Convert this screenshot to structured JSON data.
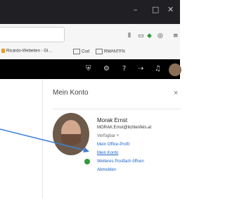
{
  "window": {
    "min_icon": "minimize-icon",
    "max_icon": "maximize-icon",
    "close_icon": "close-icon",
    "min_glyph": "–",
    "max_glyph": "□",
    "close_glyph": "✕"
  },
  "bookmarks": {
    "items": [
      "Ricardo-Webeiten - GI…",
      "Cod",
      "RWANTFN"
    ]
  },
  "panel": {
    "title": "Mein Konto",
    "close_glyph": "×",
    "name": "Morak Ernst",
    "email": "MORAK.Ernst@lichtenfels.at",
    "status": "Verfügbar ˅",
    "links": {
      "profile": "Mein Office-Profil",
      "konto": "Mein Konto",
      "postfach": "Weiteres Postfach öffnen",
      "abmelden": "Abmelden"
    }
  },
  "colors": {
    "link": "#1a64c8",
    "arrow": "#3e7fd2",
    "status_green": "#2e9b3a"
  }
}
